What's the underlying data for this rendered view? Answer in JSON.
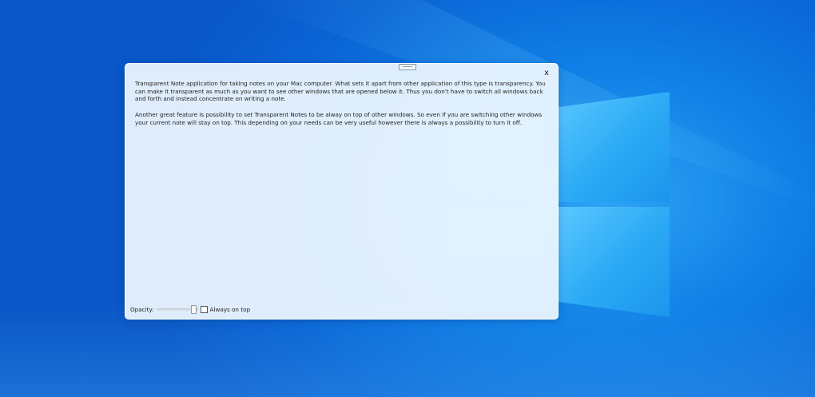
{
  "window": {
    "close_label": "x"
  },
  "note": {
    "paragraphs": [
      "Transparent Note application for taking notes on your Mac computer. What sets it apart from other application of this type is transparency. You can make it transparent as much as you want to see other windows that are opened below it. Thus you don't have to switch all windows back and forth and instead concentrate on writing a note.",
      "Another great feature is possibility to set Transparent Notes to be alway on top of other windows. So even if you are switching other windows your current note will stay on top. This depending on your needs can be very useful however there is always a possibility to turn it off."
    ]
  },
  "footer": {
    "opacity_label": "Opacity:",
    "opacity_value": 0.9,
    "always_on_top_label": "Always on top",
    "always_on_top_checked": false
  },
  "icons": {
    "grip": "drag-handle-icon",
    "close": "close-icon"
  }
}
